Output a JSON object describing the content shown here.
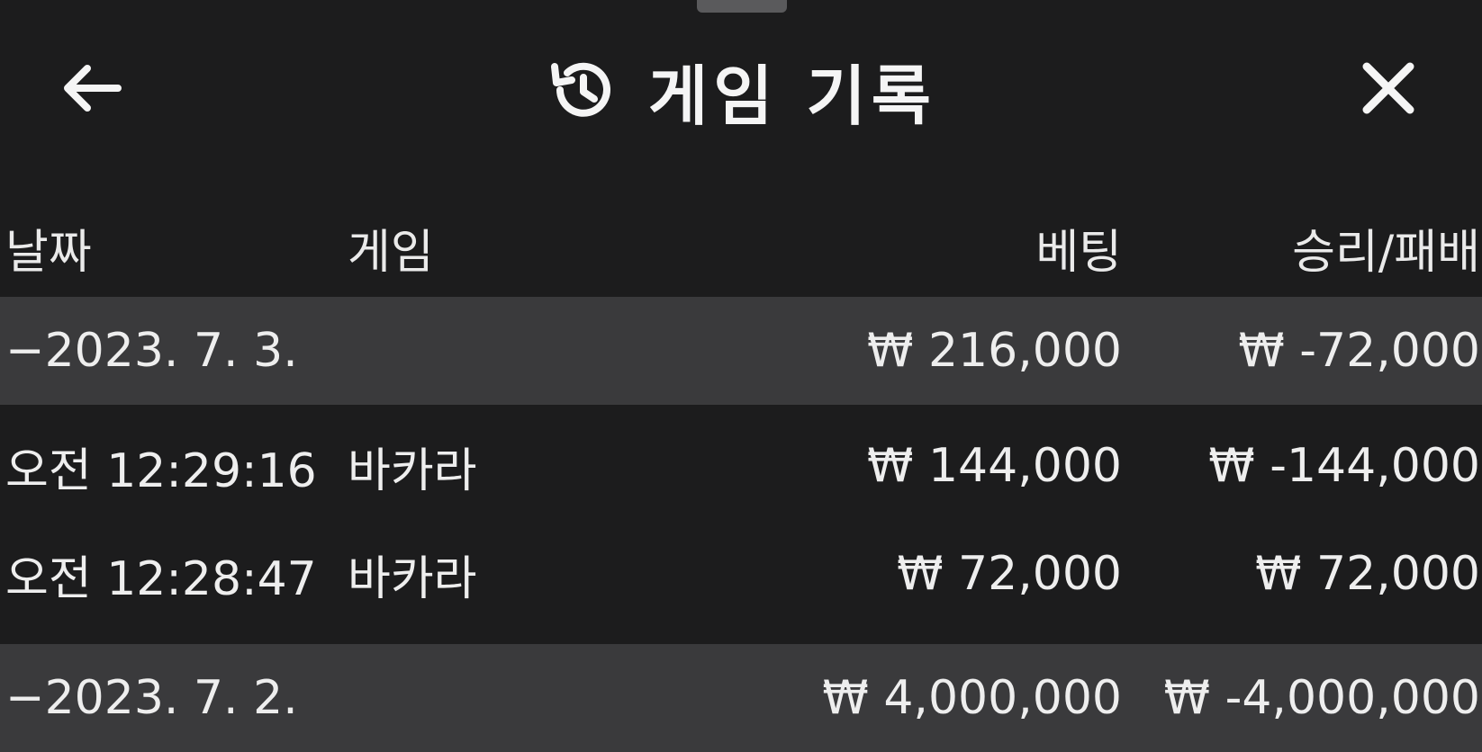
{
  "header": {
    "title": "게임 기록",
    "back_icon": "arrow-left-icon",
    "history_icon": "history-icon",
    "close_icon": "close-icon"
  },
  "table": {
    "columns": {
      "date": "날짜",
      "game": "게임",
      "bet": "베팅",
      "result": "승리/패배"
    },
    "groups": [
      {
        "date": "−2023. 7. 3.",
        "bet": "₩ 216,000",
        "result": "₩ -72,000",
        "entries": [
          {
            "time": "오전 12:29:16",
            "game": "바카라",
            "bet": "₩ 144,000",
            "result": "₩ -144,000"
          },
          {
            "time": "오전 12:28:47",
            "game": "바카라",
            "bet": "₩ 72,000",
            "result": "₩ 72,000"
          }
        ]
      },
      {
        "date": "−2023. 7. 2.",
        "bet": "₩ 4,000,000",
        "result": "₩ -4,000,000",
        "entries": []
      }
    ]
  },
  "colors": {
    "background": "#1c1c1d",
    "group_row": "#3a3a3c",
    "text": "#eeeeee"
  }
}
